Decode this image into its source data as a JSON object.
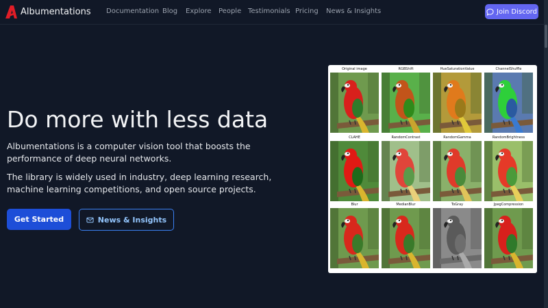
{
  "nav": {
    "brand": "Albumentations",
    "links": [
      "Documentation",
      "Blog",
      "Explore",
      "People",
      "Testimonials",
      "Pricing",
      "News & Insights"
    ],
    "discord_label": "Join Discord"
  },
  "hero": {
    "title": "Do more with less data",
    "desc1": "Albumentations is a computer vision tool that boosts the performance of deep neural networks.",
    "desc2": "The library is widely used in industry, deep learning research, machine learning competitions, and open source projects.",
    "primary_button": "Get Started",
    "secondary_button": "News & Insights"
  },
  "augmentations": [
    {
      "label": "Original image",
      "bg": "#6f9a4e",
      "bird": "#d8201c",
      "wing": "#2f7a2a",
      "tail": "#d9b52e",
      "gray": false
    },
    {
      "label": "RGBShift",
      "bg": "#59b04a",
      "bird": "#c2541a",
      "wing": "#2f8a1a",
      "tail": "#c9a42e",
      "gray": false
    },
    {
      "label": "HueSaturationValue",
      "bg": "#b39a3a",
      "bird": "#e07a1c",
      "wing": "#9a7a1a",
      "tail": "#e0c83a",
      "gray": false
    },
    {
      "label": "ChannelShuffle",
      "bg": "#5a7ab0",
      "bird": "#2ecf3a",
      "wing": "#2a5aa0",
      "tail": "#3a7ad0",
      "gray": false
    },
    {
      "label": "CLAHE",
      "bg": "#4f8a3a",
      "bird": "#e01a14",
      "wing": "#1f6a1a",
      "tail": "#d9b52e",
      "gray": false
    },
    {
      "label": "RandomContrast",
      "bg": "#a0bf8a",
      "bird": "#e0453a",
      "wing": "#5a9a4a",
      "tail": "#e9d07a",
      "gray": false
    },
    {
      "label": "RandomGamma",
      "bg": "#8ab06a",
      "bird": "#e03a2a",
      "wing": "#4a8a3a",
      "tail": "#e0c45a",
      "gray": false
    },
    {
      "label": "RandomBrightness",
      "bg": "#9abf6a",
      "bird": "#e53a28",
      "wing": "#4a9a3a",
      "tail": "#e9cf5a",
      "gray": false
    },
    {
      "label": "Blur",
      "bg": "#6f9a4e",
      "bird": "#d8281c",
      "wing": "#3a7a2a",
      "tail": "#d9b52e",
      "gray": false
    },
    {
      "label": "MedianBlur",
      "bg": "#6f9a4e",
      "bird": "#d8281c",
      "wing": "#3a7a2a",
      "tail": "#d9b52e",
      "gray": false
    },
    {
      "label": "ToGray",
      "bg": "#8a8a8a",
      "bird": "#5a5a5a",
      "wing": "#6e6e6e",
      "tail": "#aaaaaa",
      "gray": true
    },
    {
      "label": "JpegCompression",
      "bg": "#6f9a4e",
      "bird": "#d8201c",
      "wing": "#2f7a2a",
      "tail": "#d9b52e",
      "gray": false
    }
  ],
  "colors": {
    "background": "#111827",
    "primary": "#1d4ed8",
    "discord": "#6366f1",
    "outline": "#3b82f6"
  }
}
